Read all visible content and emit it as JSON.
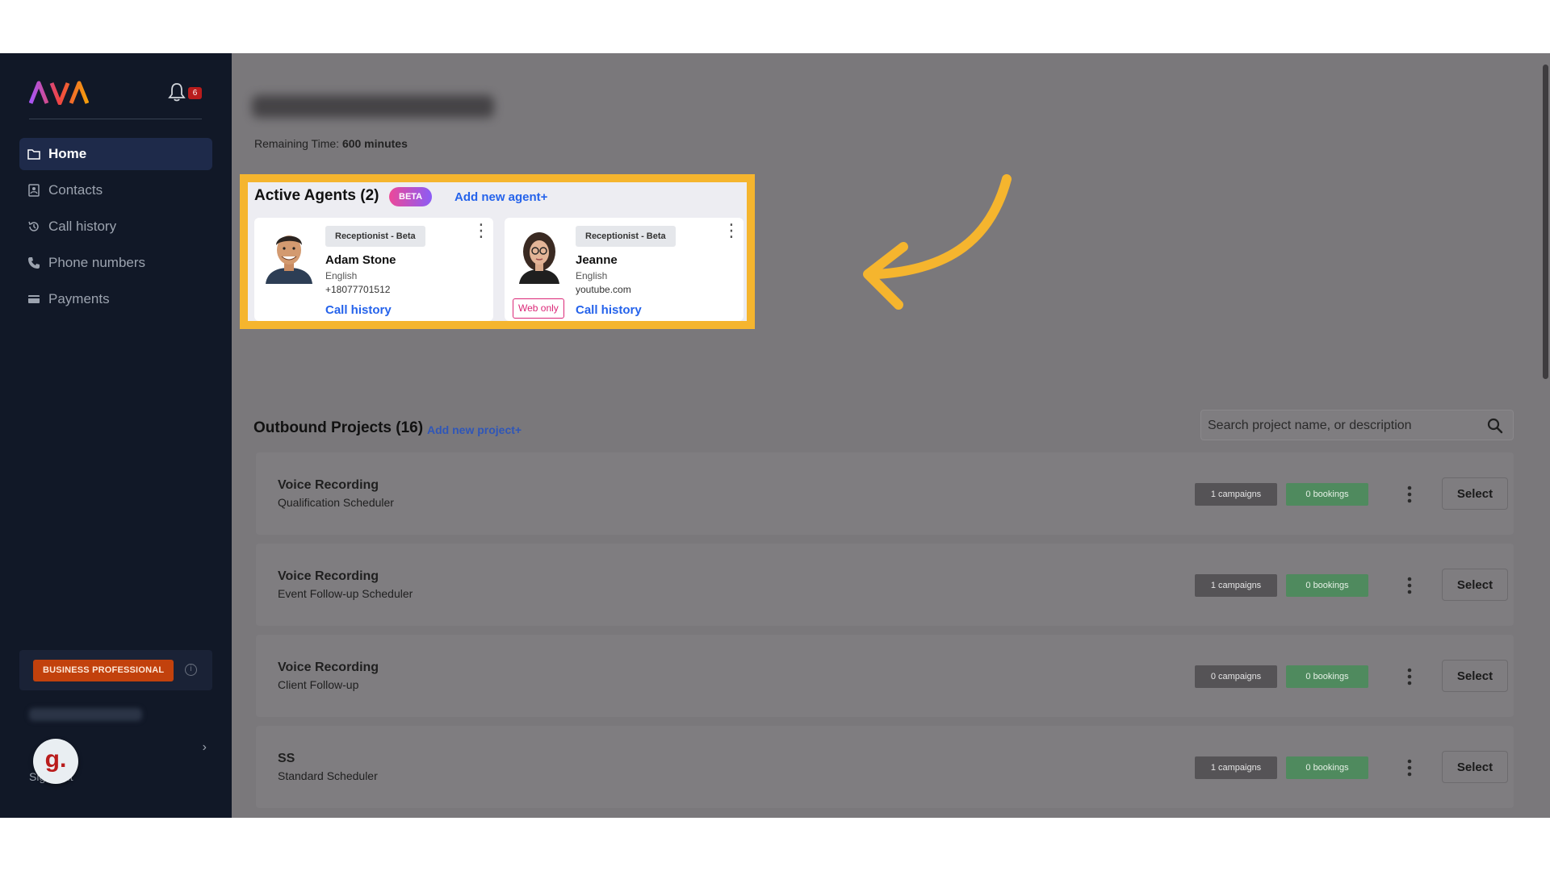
{
  "sidebar": {
    "logo_text": "AVA",
    "notifications_count": "6",
    "nav": [
      {
        "label": "Home",
        "icon": "folder-icon",
        "active": true
      },
      {
        "label": "Contacts",
        "icon": "contacts-icon"
      },
      {
        "label": "Call history",
        "icon": "history-icon"
      },
      {
        "label": "Phone numbers",
        "icon": "phone-icon"
      },
      {
        "label": "Payments",
        "icon": "card-icon"
      }
    ],
    "plan_label": "BUSINESS PROFESSIONAL",
    "signout_label": "Sign Out",
    "avatar_letter": "g."
  },
  "main": {
    "remaining_label": "Remaining Time:",
    "remaining_value": "600 minutes",
    "agents": {
      "title": "Active Agents (2)",
      "beta_label": "BETA",
      "add_label": "Add new agent+",
      "items": [
        {
          "role": "Receptionist - Beta",
          "name": "Adam Stone",
          "language": "English",
          "extra": "+18077701512",
          "call_history": "Call history"
        },
        {
          "role": "Receptionist - Beta",
          "name": "Jeanne",
          "language": "English",
          "extra": "youtube.com",
          "call_history": "Call history",
          "badge": "Web only"
        }
      ]
    },
    "projects": {
      "title": "Outbound Projects (16)",
      "add_label": "Add new project+",
      "search_placeholder": "Search project name, or description",
      "select_label": "Select",
      "items": [
        {
          "name": "Voice Recording",
          "desc": "Qualification Scheduler",
          "campaigns": "1 campaigns",
          "bookings": "0 bookings"
        },
        {
          "name": "Voice Recording",
          "desc": "Event Follow-up Scheduler",
          "campaigns": "1 campaigns",
          "bookings": "0 bookings"
        },
        {
          "name": "Voice Recording",
          "desc": "Client Follow-up",
          "campaigns": "0 campaigns",
          "bookings": "0 bookings"
        },
        {
          "name": "SS",
          "desc": "Standard Scheduler",
          "campaigns": "1 campaigns",
          "bookings": "0 bookings"
        }
      ]
    }
  },
  "colors": {
    "sidebar_bg": "#111827",
    "accent_blue": "#2563eb",
    "highlight": "#f5b52e",
    "plan_badge": "#c2410c",
    "bookings_green": "#4f8a5e"
  }
}
